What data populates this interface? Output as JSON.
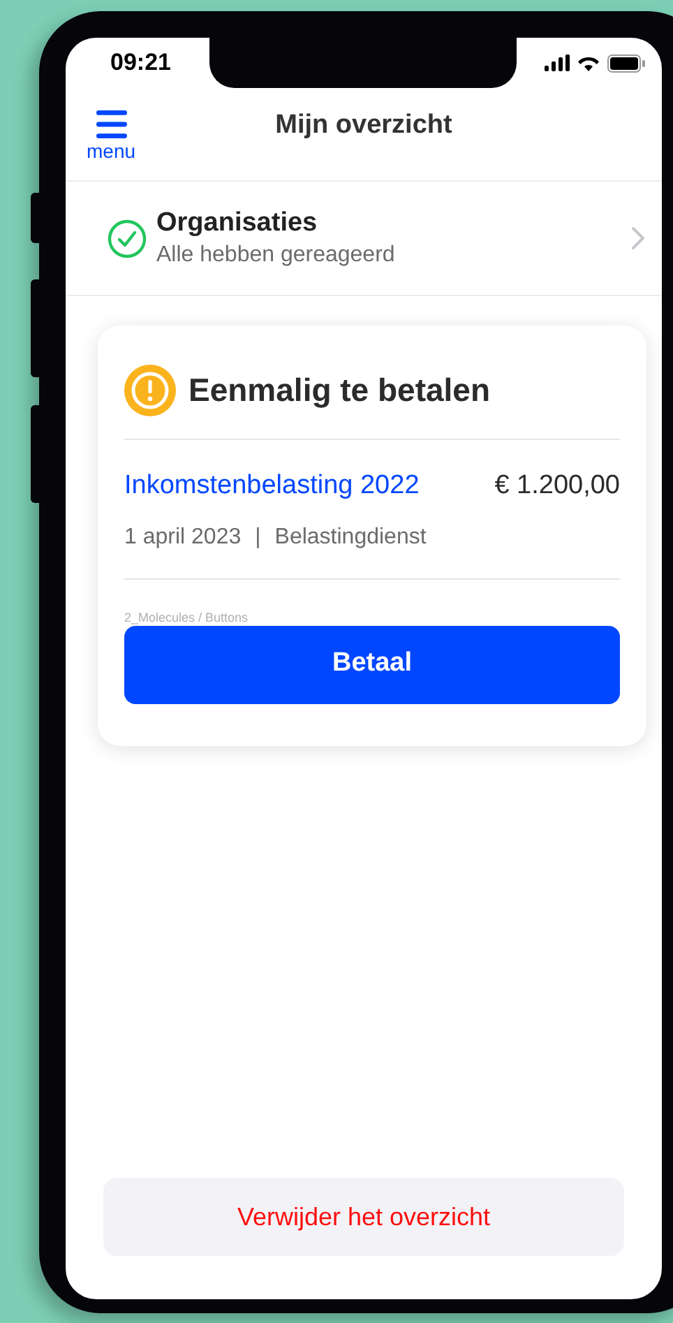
{
  "status_bar": {
    "time": "09:21"
  },
  "nav": {
    "menu_label": "menu",
    "title": "Mijn overzicht"
  },
  "organisations": {
    "title": "Organisaties",
    "subtitle": "Alle hebben gereageerd",
    "done": true
  },
  "card": {
    "title": "Eenmalig te betalen",
    "item": {
      "title": "Inkomstenbelasting 2022",
      "amount": "€ 1.200,00",
      "date": "1 april 2023",
      "separator": "|",
      "source": "Belastingdienst"
    },
    "component_label": "2_Molecules / Buttons",
    "button": "Betaal"
  },
  "delete_button": "Verwijder het overzicht"
}
